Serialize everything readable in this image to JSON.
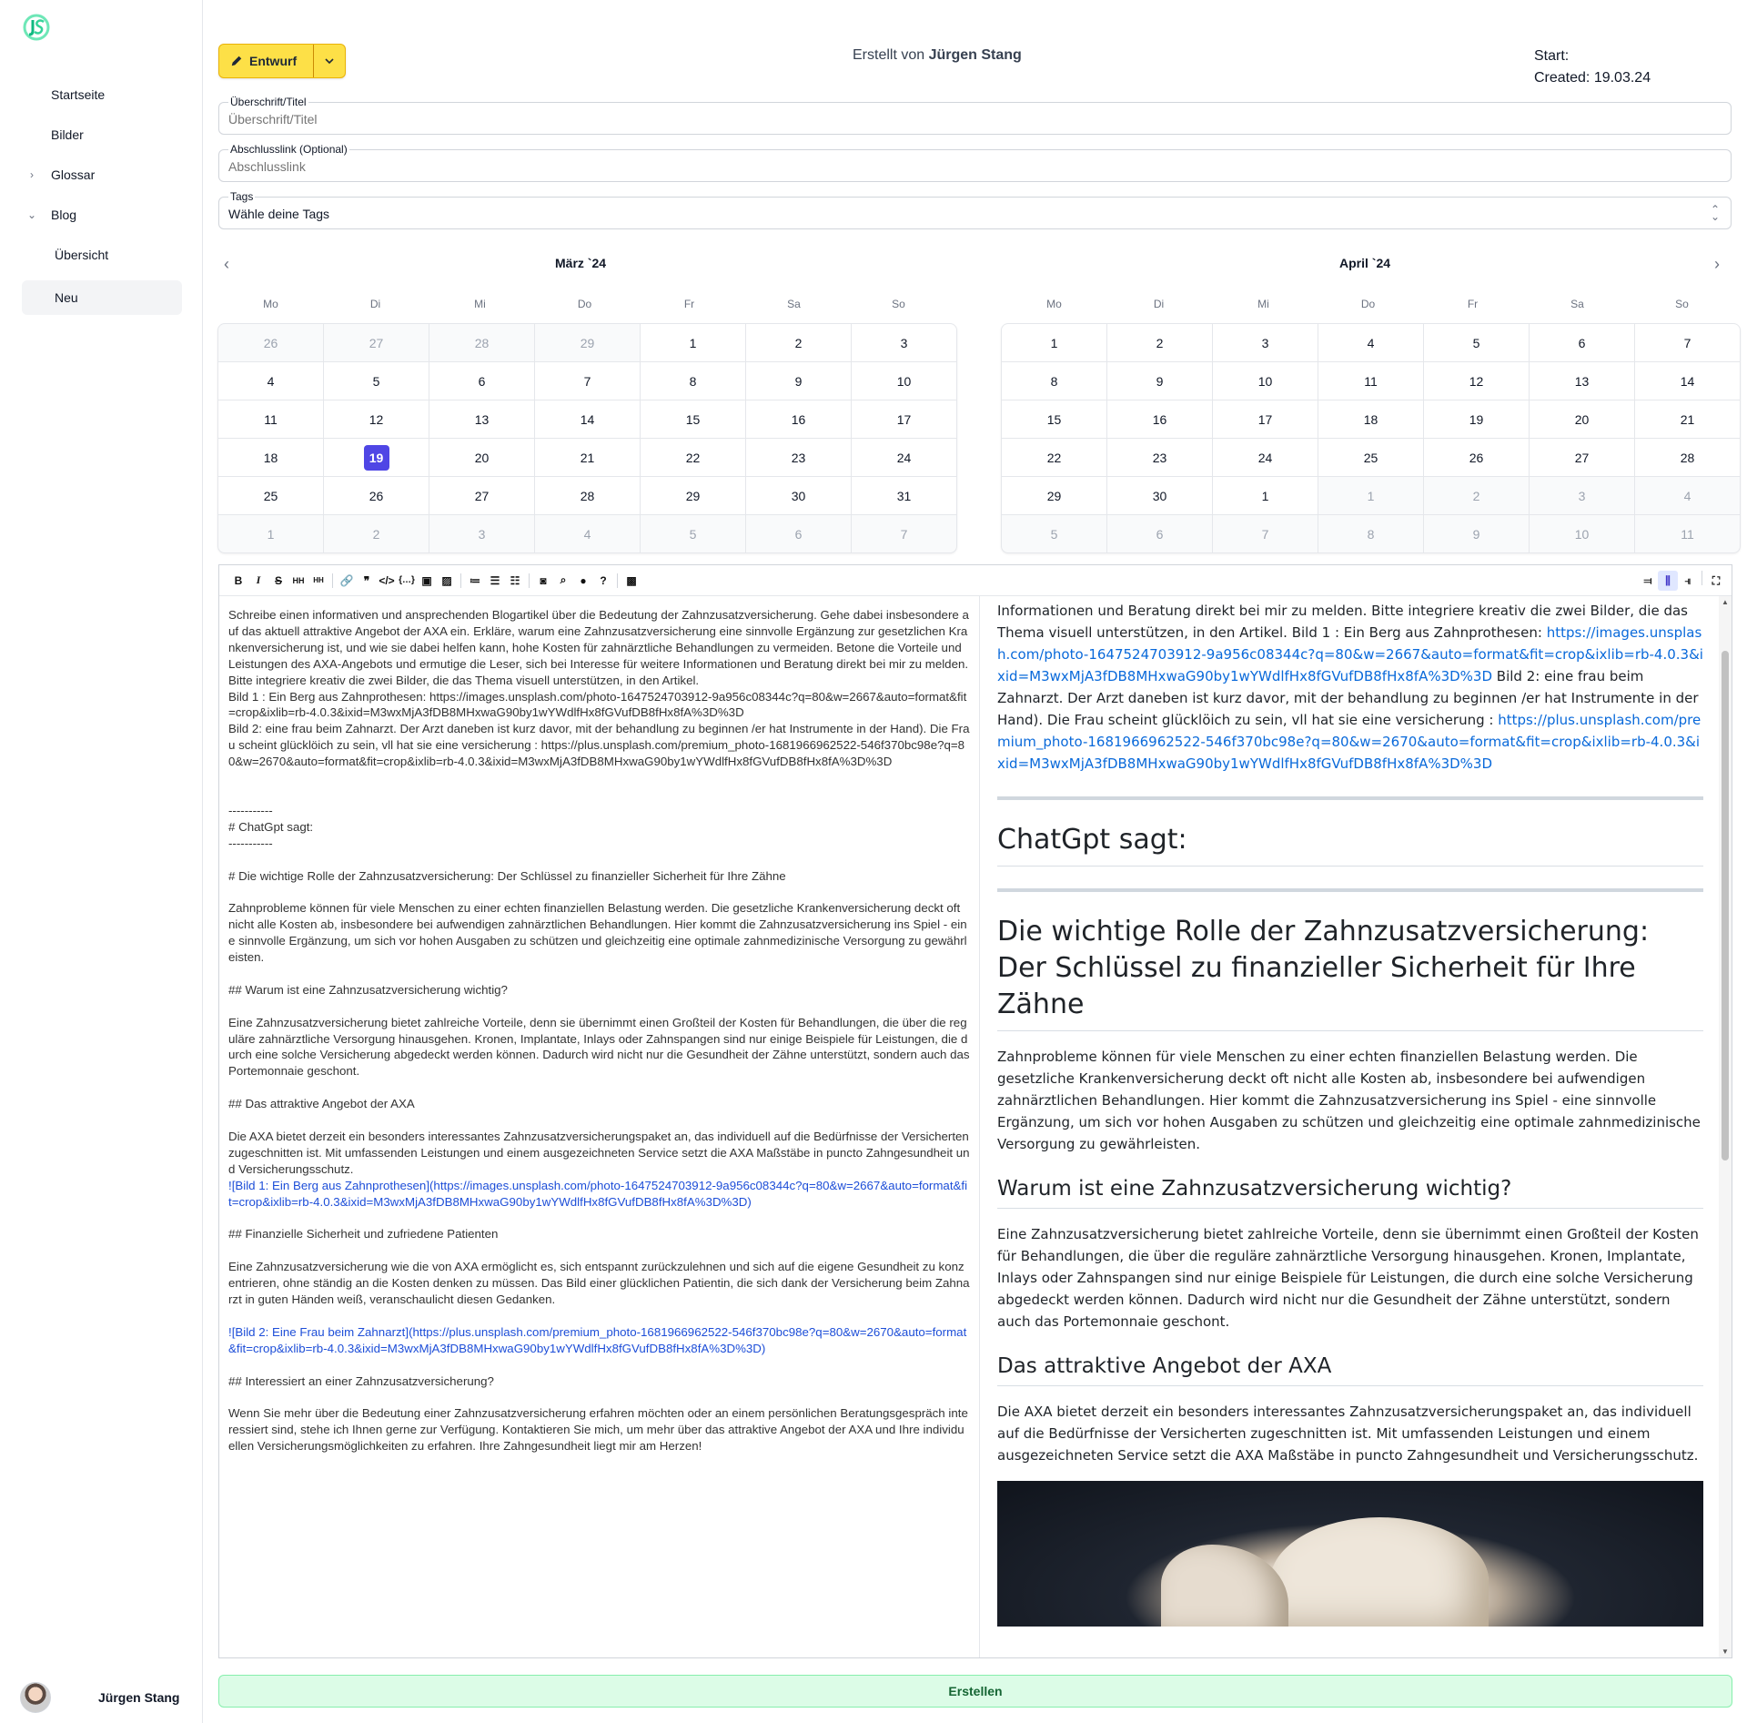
{
  "sidebar": {
    "items": [
      {
        "label": "Startseite"
      },
      {
        "label": "Bilder"
      },
      {
        "label": "Glossar"
      },
      {
        "label": "Blog"
      },
      {
        "label": "Übersicht"
      },
      {
        "label": "Neu"
      }
    ],
    "user_name": "Jürgen Stang"
  },
  "header": {
    "status_label": "Entwurf",
    "created_by_prefix": "Erstellt von",
    "created_by_name": "Jürgen Stang",
    "start_label": "Start:",
    "created_label": "Created: 19.03.24"
  },
  "form": {
    "title_label": "Überschrift/Titel",
    "title_placeholder": "Überschrift/Titel",
    "link_label": "Abschlusslink (Optional)",
    "link_placeholder": "Abschlusslink",
    "tags_label": "Tags",
    "tags_value": "Wähle deine Tags"
  },
  "calendar": {
    "weekdays": [
      "Mo",
      "Di",
      "Mi",
      "Do",
      "Fr",
      "Sa",
      "So"
    ],
    "months": [
      {
        "title": "März `24",
        "days": [
          "26",
          "27",
          "28",
          "29",
          "1",
          "2",
          "3",
          "4",
          "5",
          "6",
          "7",
          "8",
          "9",
          "10",
          "11",
          "12",
          "13",
          "14",
          "15",
          "16",
          "17",
          "18",
          "19",
          "20",
          "21",
          "22",
          "23",
          "24",
          "25",
          "26",
          "27",
          "28",
          "29",
          "30",
          "31",
          "1",
          "2",
          "3",
          "4",
          "5",
          "6",
          "7"
        ],
        "outside": [
          0,
          1,
          2,
          3,
          35,
          36,
          37,
          38,
          39,
          40,
          41
        ],
        "selected": 22
      },
      {
        "title": "April `24",
        "days": [
          "1",
          "2",
          "3",
          "4",
          "5",
          "6",
          "7",
          "8",
          "9",
          "10",
          "11",
          "12",
          "13",
          "14",
          "15",
          "16",
          "17",
          "18",
          "19",
          "20",
          "21",
          "22",
          "23",
          "24",
          "25",
          "26",
          "27",
          "28",
          "29",
          "30",
          "1",
          "1",
          "2",
          "3",
          "4",
          "5",
          "6",
          "7",
          "8",
          "9",
          "10",
          "11"
        ],
        "outside": [
          31,
          32,
          33,
          34,
          35,
          36,
          37,
          38,
          39,
          40,
          41
        ],
        "selected": -1
      }
    ]
  },
  "editor": {
    "toolbar_left": [
      "bold-icon",
      "italic-icon",
      "strikethrough-icon",
      "heading-icon",
      "heading-small-icon",
      "link-icon",
      "quote-icon",
      "code-icon",
      "code-block-icon",
      "comment-icon",
      "image-icon",
      "unordered-list-icon",
      "ordered-list-icon",
      "task-list-icon",
      "robot-icon",
      "search-icon",
      "lightbulb-icon",
      "help-icon",
      "picture-icon"
    ],
    "toolbar_right": [
      "edit-mode-icon",
      "split-mode-icon",
      "preview-mode-icon",
      "fullscreen-icon"
    ],
    "source_text": "Schreibe einen informativen und ansprechenden Blogartikel über die Bedeutung der Zahnzusatzversicherung. Gehe dabei insbesondere auf das aktuell attraktive Angebot der AXA ein. Erkläre, warum eine Zahnzusatzversicherung eine sinnvolle Ergänzung zur gesetzlichen Krankenversicherung ist, und wie sie dabei helfen kann, hohe Kosten für zahnärztliche Behandlungen zu vermeiden. Betone die Vorteile und Leistungen des AXA-Angebots und ermutige die Leser, sich bei Interesse für weitere Informationen und Beratung direkt bei mir zu melden. Bitte integriere kreativ die zwei Bilder, die das Thema visuell unterstützen, in den Artikel.\nBild 1 : Ein Berg aus Zahnprothesen: https://images.unsplash.com/photo-1647524703912-9a956c08344c?q=80&w=2667&auto=format&fit=crop&ixlib=rb-4.0.3&ixid=M3wxMjA3fDB8MHxwaG90by1wYWdlfHx8fGVufDB8fHx8fA%3D%3D\nBild 2: eine frau beim Zahnarzt. Der Arzt daneben ist kurz davor, mit der behandlung zu beginnen /er hat Instrumente in der Hand). Die Frau scheint glücklöich zu sein, vll hat sie eine versicherung : https://plus.unsplash.com/premium_photo-1681966962522-546f370bc98e?q=80&w=2670&auto=format&fit=crop&ixlib=rb-4.0.3&ixid=M3wxMjA3fDB8MHxwaG90by1wYWdlfHx8fGVufDB8fHx8fA%3D%3D\n\n\n-----------\n# ChatGpt sagt:\n-----------\n\n# Die wichtige Rolle der Zahnzusatzversicherung: Der Schlüssel zu finanzieller Sicherheit für Ihre Zähne\n\nZahnprobleme können für viele Menschen zu einer echten finanziellen Belastung werden. Die gesetzliche Krankenversicherung deckt oft nicht alle Kosten ab, insbesondere bei aufwendigen zahnärztlichen Behandlungen. Hier kommt die Zahnzusatzversicherung ins Spiel - eine sinnvolle Ergänzung, um sich vor hohen Ausgaben zu schützen und gleichzeitig eine optimale zahnmedizinische Versorgung zu gewährleisten.\n\n## Warum ist eine Zahnzusatzversicherung wichtig?\n\nEine Zahnzusatzversicherung bietet zahlreiche Vorteile, denn sie übernimmt einen Großteil der Kosten für Behandlungen, die über die reguläre zahnärztliche Versorgung hinausgehen. Kronen, Implantate, Inlays oder Zahnspangen sind nur einige Beispiele für Leistungen, die durch eine solche Versicherung abgedeckt werden können. Dadurch wird nicht nur die Gesundheit der Zähne unterstützt, sondern auch das Portemonnaie geschont.\n\n## Das attraktive Angebot der AXA\n\nDie AXA bietet derzeit ein besonders interessantes Zahnzusatzversicherungspaket an, das individuell auf die Bedürfnisse der Versicherten zugeschnitten ist. Mit umfassenden Leistungen und einem ausgezeichneten Service setzt die AXA Maßstäbe in puncto Zahngesundheit und Versicherungsschutz.\n",
    "source_link1": "![Bild 1: Ein Berg aus Zahnprothesen](https://images.unsplash.com/photo-1647524703912-9a956c08344c?q=80&w=2667&auto=format&fit=crop&ixlib=rb-4.0.3&ixid=M3wxMjA3fDB8MHxwaG90by1wYWdlfHx8fGVufDB8fHx8fA%3D%3D)",
    "source_mid": "\n\n## Finanzielle Sicherheit und zufriedene Patienten\n\nEine Zahnzusatzversicherung wie die von AXA ermöglicht es, sich entspannt zurückzulehnen und sich auf die eigene Gesundheit zu konzentrieren, ohne ständig an die Kosten denken zu müssen. Das Bild einer glücklichen Patientin, die sich dank der Versicherung beim Zahnarzt in guten Händen weiß, veranschaulicht diesen Gedanken.\n\n",
    "source_link2": "![Bild 2: Eine Frau beim Zahnarzt](https://plus.unsplash.com/premium_photo-1681966962522-546f370bc98e?q=80&w=2670&auto=format&fit=crop&ixlib=rb-4.0.3&ixid=M3wxMjA3fDB8MHxwaG90by1wYWdlfHx8fGVufDB8fHx8fA%3D%3D)",
    "source_end": "\n\n## Interessiert an einer Zahnzusatzversicherung?\n\nWenn Sie mehr über die Bedeutung einer Zahnzusatzversicherung erfahren möchten oder an einem persönlichen Beratungsgespräch interessiert sind, stehe ich Ihnen gerne zur Verfügung. Kontaktieren Sie mich, um mehr über das attraktive Angebot der AXA und Ihre individuellen Versicherungsmöglichkeiten zu erfahren. Ihre Zahngesundheit liegt mir am Herzen!"
  },
  "preview": {
    "intro_text": "Vorteile und Leistungen des AXA-Angebots und ermutige die Leser, sich bei Interesse für weitere Informationen und Beratung direkt bei mir zu melden. Bitte integriere kreativ die zwei Bilder, die das Thema visuell unterstützen, in den Artikel. Bild 1 : Ein Berg aus Zahnprothesen: ",
    "link1": "https://images.unsplash.com/photo-1647524703912-9a956c08344c?q=80&w=2667&auto=format&fit=crop&ixlib=rb-4.0.3&ixid=M3wxMjA3fDB8MHxwaG90by1wYWdlfHx8fGVufDB8fHx8fA%3D%3D",
    "mid_text": " Bild 2: eine frau beim Zahnarzt. Der Arzt daneben ist kurz davor, mit der behandlung zu beginnen /er hat Instrumente in der Hand). Die Frau scheint glücklöich zu sein, vll hat sie eine versicherung : ",
    "link2": "https://plus.unsplash.com/premium_photo-1681966962522-546f370bc98e?q=80&w=2670&auto=format&fit=crop&ixlib=rb-4.0.3&ixid=M3wxMjA3fDB8MHxwaG90by1wYWdlfHx8fGVufDB8fHx8fA%3D%3D",
    "h_chatgpt": "ChatGpt sagt:",
    "h_main": "Die wichtige Rolle der Zahnzusatzversicherung: Der Schlüssel zu finanzieller Sicherheit für Ihre Zähne",
    "p1": "Zahnprobleme können für viele Menschen zu einer echten finanziellen Belastung werden. Die gesetzliche Krankenversicherung deckt oft nicht alle Kosten ab, insbesondere bei aufwendigen zahnärztlichen Behandlungen. Hier kommt die Zahnzusatzversicherung ins Spiel - eine sinnvolle Ergänzung, um sich vor hohen Ausgaben zu schützen und gleichzeitig eine optimale zahnmedizinische Versorgung zu gewährleisten.",
    "h2_1": "Warum ist eine Zahnzusatzversicherung wichtig?",
    "p2": "Eine Zahnzusatzversicherung bietet zahlreiche Vorteile, denn sie übernimmt einen Großteil der Kosten für Behandlungen, die über die reguläre zahnärztliche Versorgung hinausgehen. Kronen, Implantate, Inlays oder Zahnspangen sind nur einige Beispiele für Leistungen, die durch eine solche Versicherung abgedeckt werden können. Dadurch wird nicht nur die Gesundheit der Zähne unterstützt, sondern auch das Portemonnaie geschont.",
    "h2_2": "Das attraktive Angebot der AXA",
    "p3": "Die AXA bietet derzeit ein besonders interessantes Zahnzusatzversicherungspaket an, das individuell auf die Bedürfnisse der Versicherten zugeschnitten ist. Mit umfassenden Leistungen und einem ausgezeichneten Service setzt die AXA Maßstäbe in puncto Zahngesundheit und Versicherungsschutz."
  },
  "footer": {
    "submit_label": "Erstellen"
  },
  "colors": {
    "status_yellow": "#fde047",
    "selected_day": "#4f46e5",
    "submit_green": "#dcfce7",
    "link_blue": "#0969da"
  }
}
